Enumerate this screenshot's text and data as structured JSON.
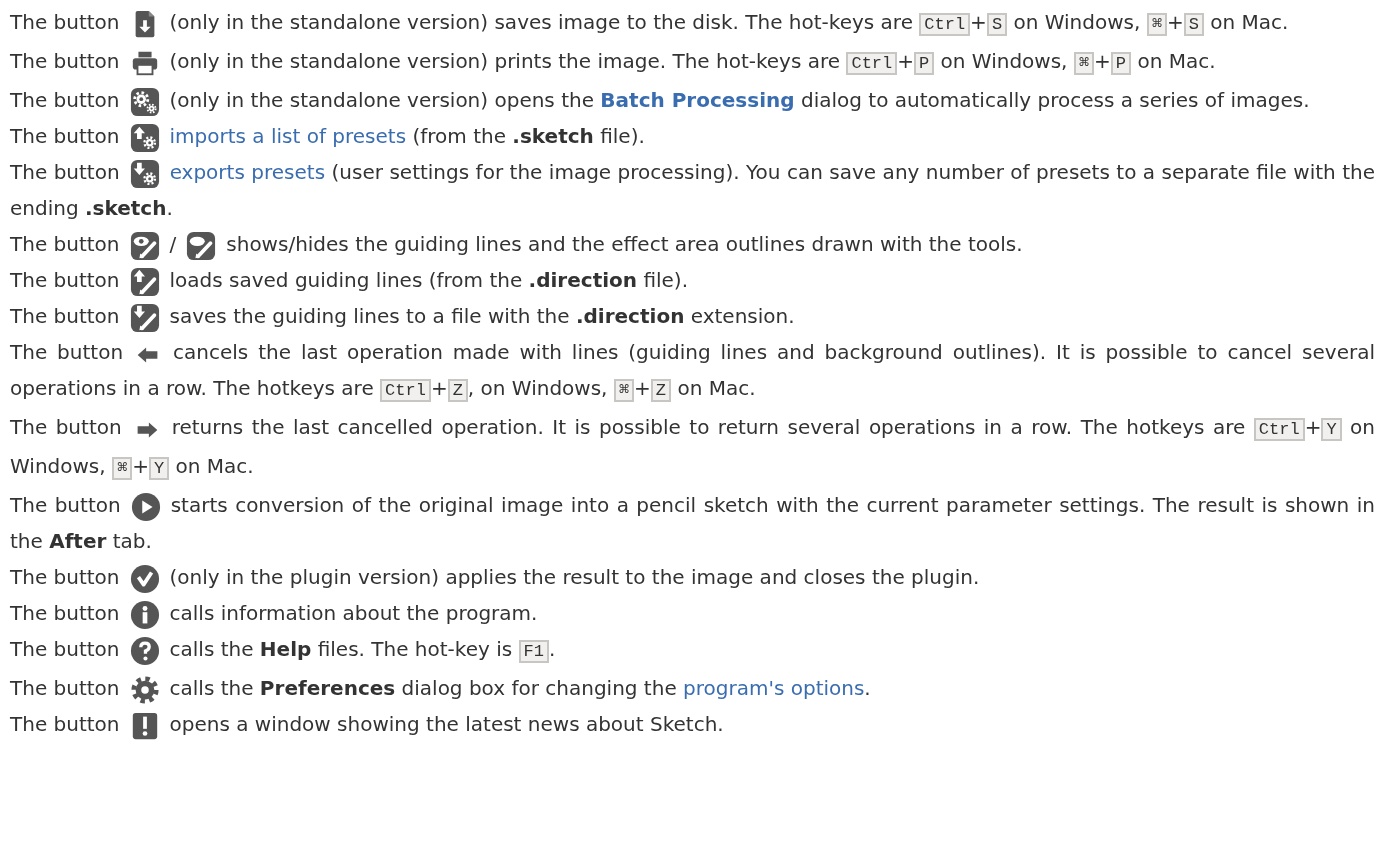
{
  "paragraphs": [
    {
      "parts": [
        {
          "kind": "text",
          "text": "The button"
        },
        {
          "kind": "disk"
        },
        {
          "kind": "text",
          "text": "(only in the standalone version) saves image to the disk. The hot-keys are "
        },
        {
          "kind": "key",
          "text": "Ctrl"
        },
        {
          "kind": "text",
          "text": "+"
        },
        {
          "kind": "key",
          "text": "S"
        },
        {
          "kind": "text",
          "text": " on Windows, "
        },
        {
          "kind": "key",
          "text": "⌘"
        },
        {
          "kind": "text",
          "text": "+"
        },
        {
          "kind": "key",
          "text": "S"
        },
        {
          "kind": "text",
          "text": " on Mac."
        }
      ]
    },
    {
      "parts": [
        {
          "kind": "text",
          "text": "The button"
        },
        {
          "kind": "printer"
        },
        {
          "kind": "text",
          "text": "(only in the standalone version) prints the image. The hot-keys are "
        },
        {
          "kind": "key",
          "text": "Ctrl"
        },
        {
          "kind": "text",
          "text": "+"
        },
        {
          "kind": "key",
          "text": "P"
        },
        {
          "kind": "text",
          "text": " on Windows, "
        },
        {
          "kind": "key",
          "text": "⌘"
        },
        {
          "kind": "text",
          "text": "+"
        },
        {
          "kind": "key",
          "text": "P"
        },
        {
          "kind": "text",
          "text": " on Mac."
        }
      ]
    },
    {
      "parts": [
        {
          "kind": "text",
          "text": "The button"
        },
        {
          "kind": "gears"
        },
        {
          "kind": "text",
          "text": "(only in the standalone version) opens the "
        },
        {
          "kind": "link",
          "text": "Batch Processing",
          "strong": true
        },
        {
          "kind": "text",
          "text": " dialog to automatically process a series of images."
        }
      ]
    },
    {
      "parts": [
        {
          "kind": "text",
          "text": "The button"
        },
        {
          "kind": "importgear"
        },
        {
          "kind": "link",
          "text": "imports a list of presets",
          "strong": false
        },
        {
          "kind": "text",
          "text": " (from the **.sketch** file)."
        }
      ]
    },
    {
      "parts": [
        {
          "kind": "text",
          "text": "The button"
        },
        {
          "kind": "exportgear"
        },
        {
          "kind": "link",
          "text": "exports presets",
          "strong": false
        },
        {
          "kind": "text",
          "text": " (user settings for the image processing). You can save any number of presets to a separate file with the ending **.sketch**."
        }
      ]
    },
    {
      "parts": [
        {
          "kind": "text",
          "text": "The button"
        },
        {
          "kind": "eyepen"
        },
        {
          "kind": "text",
          "text": "/"
        },
        {
          "kind": "hidepen"
        },
        {
          "kind": "text",
          "text": "shows/hides the guiding lines and the effect area outlines drawn with the tools."
        }
      ]
    },
    {
      "parts": [
        {
          "kind": "text",
          "text": "The button"
        },
        {
          "kind": "loadpen"
        },
        {
          "kind": "text",
          "text": "loads saved guiding lines (from the **.direction** file)."
        }
      ]
    },
    {
      "parts": [
        {
          "kind": "text",
          "text": "The button"
        },
        {
          "kind": "savepen"
        },
        {
          "kind": "text",
          "text": "saves the guiding lines to a file with the **.direction** extension."
        }
      ]
    },
    {
      "parts": [
        {
          "kind": "text",
          "text": "The button"
        },
        {
          "kind": "left"
        },
        {
          "kind": "text",
          "text": "cancels the last operation made with lines (guiding lines and background outlines). It is possible to cancel several operations in a row. The hotkeys are "
        },
        {
          "kind": "key",
          "text": "Ctrl"
        },
        {
          "kind": "text",
          "text": "+"
        },
        {
          "kind": "key",
          "text": "Z"
        },
        {
          "kind": "text",
          "text": ", on Windows, "
        },
        {
          "kind": "key",
          "text": "⌘"
        },
        {
          "kind": "text",
          "text": "+"
        },
        {
          "kind": "key",
          "text": "Z"
        },
        {
          "kind": "text",
          "text": " on Mac."
        }
      ]
    },
    {
      "parts": [
        {
          "kind": "text",
          "text": "The button"
        },
        {
          "kind": "right"
        },
        {
          "kind": "text",
          "text": "returns the last cancelled operation. It is possible to return several operations in a row. The hotkeys are "
        },
        {
          "kind": "key",
          "text": "Ctrl"
        },
        {
          "kind": "text",
          "text": "+"
        },
        {
          "kind": "key",
          "text": "Y"
        },
        {
          "kind": "text",
          "text": " on Windows, "
        },
        {
          "kind": "key",
          "text": "⌘"
        },
        {
          "kind": "text",
          "text": "+"
        },
        {
          "kind": "key",
          "text": "Y"
        },
        {
          "kind": "text",
          "text": " on Mac."
        }
      ]
    },
    {
      "parts": [
        {
          "kind": "text",
          "text": "The button"
        },
        {
          "kind": "play"
        },
        {
          "kind": "text",
          "text": "starts conversion of the original image into a pencil sketch with the current parameter settings. The result is shown in the **After** tab."
        }
      ]
    },
    {
      "parts": [
        {
          "kind": "text",
          "text": "The button"
        },
        {
          "kind": "check"
        },
        {
          "kind": "text",
          "text": "(only in the plugin version) applies the result to the image and closes the plugin."
        }
      ]
    },
    {
      "parts": [
        {
          "kind": "text",
          "text": "The button"
        },
        {
          "kind": "info"
        },
        {
          "kind": "text",
          "text": "calls information about the program."
        }
      ]
    },
    {
      "parts": [
        {
          "kind": "text",
          "text": "The button"
        },
        {
          "kind": "help"
        },
        {
          "kind": "text",
          "text": "calls the **Help** files. The hot-key is "
        },
        {
          "kind": "key",
          "text": "F1"
        },
        {
          "kind": "text",
          "text": "."
        }
      ]
    },
    {
      "parts": [
        {
          "kind": "text",
          "text": "The button"
        },
        {
          "kind": "gear"
        },
        {
          "kind": "text",
          "text": "calls the **Preferences** dialog box for changing the "
        },
        {
          "kind": "link",
          "text": "program's options",
          "strong": false
        },
        {
          "kind": "text",
          "text": "."
        }
      ]
    },
    {
      "parts": [
        {
          "kind": "text",
          "text": "The button"
        },
        {
          "kind": "alert"
        },
        {
          "kind": "text",
          "text": "opens a window showing the latest news about Sketch."
        }
      ]
    }
  ]
}
